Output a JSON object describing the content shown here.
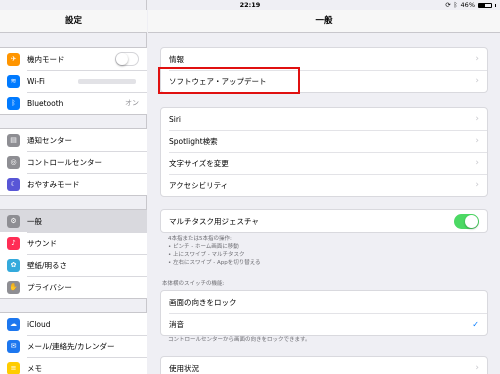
{
  "status": {
    "device": "iPad",
    "time": "22:19",
    "battery": "46%"
  },
  "sidebar": {
    "title": "設定",
    "groups": [
      {
        "items": [
          {
            "label": "機内モード",
            "icon": "airplane-icon",
            "color": "#ff9500",
            "glyph": "✈"
          },
          {
            "label": "Wi-Fi",
            "icon": "wifi-icon",
            "color": "#007aff",
            "glyph": "≋"
          },
          {
            "label": "Bluetooth",
            "icon": "bluetooth-icon",
            "color": "#007aff",
            "glyph": "ᛒ",
            "value": "オン"
          }
        ]
      },
      {
        "items": [
          {
            "label": "通知センター",
            "icon": "notification-center-icon",
            "color": "#8e8e93",
            "glyph": "▤"
          },
          {
            "label": "コントロールセンター",
            "icon": "control-center-icon",
            "color": "#8e8e93",
            "glyph": "◎"
          },
          {
            "label": "おやすみモード",
            "icon": "moon-icon",
            "color": "#5856d6",
            "glyph": "☾"
          }
        ]
      },
      {
        "items": [
          {
            "label": "一般",
            "icon": "gear-icon",
            "color": "#8e8e93",
            "glyph": "⚙"
          },
          {
            "label": "サウンド",
            "icon": "speaker-icon",
            "color": "#ff2d55",
            "glyph": "♪"
          },
          {
            "label": "壁紙/明るさ",
            "icon": "wallpaper-icon",
            "color": "#34aadc",
            "glyph": "✿"
          },
          {
            "label": "プライバシー",
            "icon": "hand-icon",
            "color": "#8e8e93",
            "glyph": "✋"
          }
        ]
      },
      {
        "items": [
          {
            "label": "iCloud",
            "icon": "cloud-icon",
            "color": "#1d77ef",
            "glyph": "☁"
          },
          {
            "label": "メール/連絡先/カレンダー",
            "icon": "mail-icon",
            "color": "#1d77ef",
            "glyph": "✉"
          },
          {
            "label": "メモ",
            "icon": "notes-icon",
            "color": "#ffcc00",
            "glyph": "≡"
          }
        ]
      }
    ]
  },
  "main": {
    "title": "一般",
    "info": "情報",
    "software_update": "ソフトウェア・アップデート",
    "siri": "Siri",
    "spotlight": "Spotlight検索",
    "text_size": "文字サイズを変更",
    "accessibility": "アクセシビリティ",
    "multitask": "マルチタスク用ジェスチャ",
    "multitask_note": [
      "4本指または5本指の操作:",
      "• ピンチ - ホーム画面に移動",
      "• 上にスワイプ - マルチタスク",
      "• 左右にスワイプ - Appを切り替える"
    ],
    "side_switch_header": "本体横のスイッチの機能:",
    "lock_rotation": "画面の向きをロック",
    "mute": "消音",
    "side_switch_note": "コントロールセンターから画面の向きをロックできます。",
    "usage": "使用状況"
  }
}
